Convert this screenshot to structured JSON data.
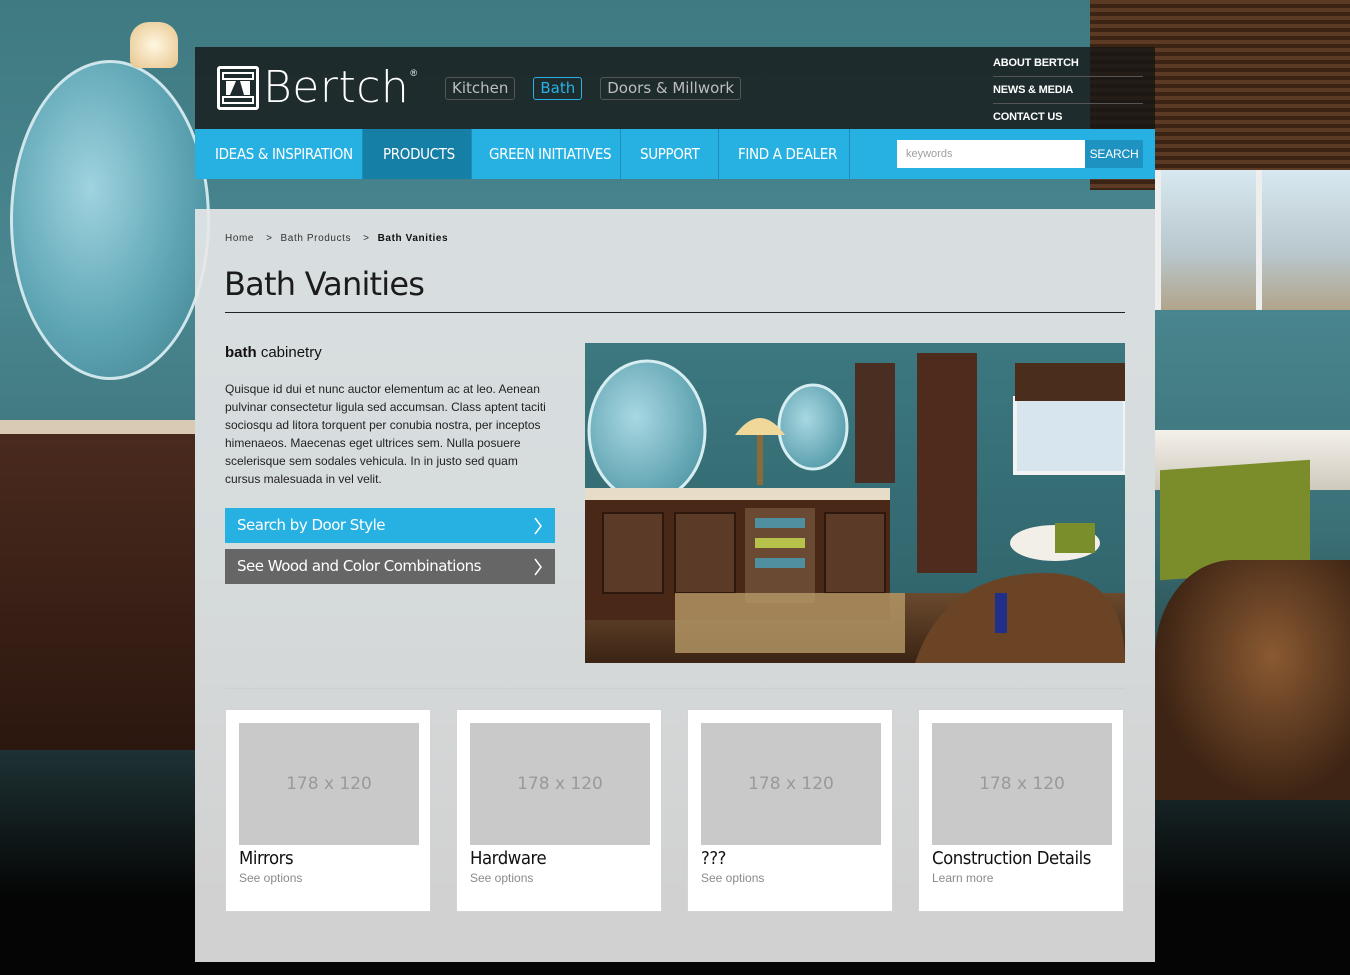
{
  "brand": {
    "name": "Bertch",
    "registered": "®"
  },
  "category_tabs": [
    {
      "label": "Kitchen",
      "active": false
    },
    {
      "label": "Bath",
      "active": true
    },
    {
      "label": "Doors & Millwork",
      "active": false
    }
  ],
  "utility_links": [
    "ABOUT BERTCH",
    "NEWS & MEDIA",
    "CONTACT US"
  ],
  "main_nav": {
    "items": [
      "IDEAS & INSPIRATION",
      "PRODUCTS",
      "GREEN INITIATIVES",
      "SUPPORT",
      "FIND A DEALER"
    ],
    "active": "PRODUCTS",
    "search_placeholder": "keywords",
    "search_button": "SEARCH"
  },
  "breadcrumb": {
    "items": [
      "Home",
      "Bath Products"
    ],
    "separator": ">",
    "current": "Bath Vanities"
  },
  "page": {
    "title": "Bath Vanities",
    "section_heading_bold": "bath",
    "section_heading_rest": "cabinetry",
    "body": "Quisque id dui et nunc auctor elementum ac at leo. Aenean pulvinar consectetur ligula sed accumsan. Class aptent taciti sociosqu ad litora torquent per conubia nostra, per inceptos himenaeos. Maecenas eget ultrices sem. Nulla posuere scelerisque sem sodales vehicula. In in justo sed quam cursus malesuada in vel velit.",
    "cta_primary": "Search by Door Style",
    "cta_secondary": "See Wood and Color Combinations"
  },
  "cards": [
    {
      "thumb": "178 x 120",
      "title": "Mirrors",
      "link": "See options"
    },
    {
      "thumb": "178 x 120",
      "title": "Hardware",
      "link": "See options"
    },
    {
      "thumb": "178 x 120",
      "title": "???",
      "link": "See options"
    },
    {
      "thumb": "178 x 120",
      "title": "Construction Details",
      "link": "Learn more"
    }
  ],
  "colors": {
    "accent_blue": "#27b1e3",
    "nav_active": "#167fa6",
    "header_dark": "#141414",
    "cta_grey": "#666666"
  },
  "icons": [
    "bertch-logo-icon",
    "chevron-right-icon"
  ]
}
